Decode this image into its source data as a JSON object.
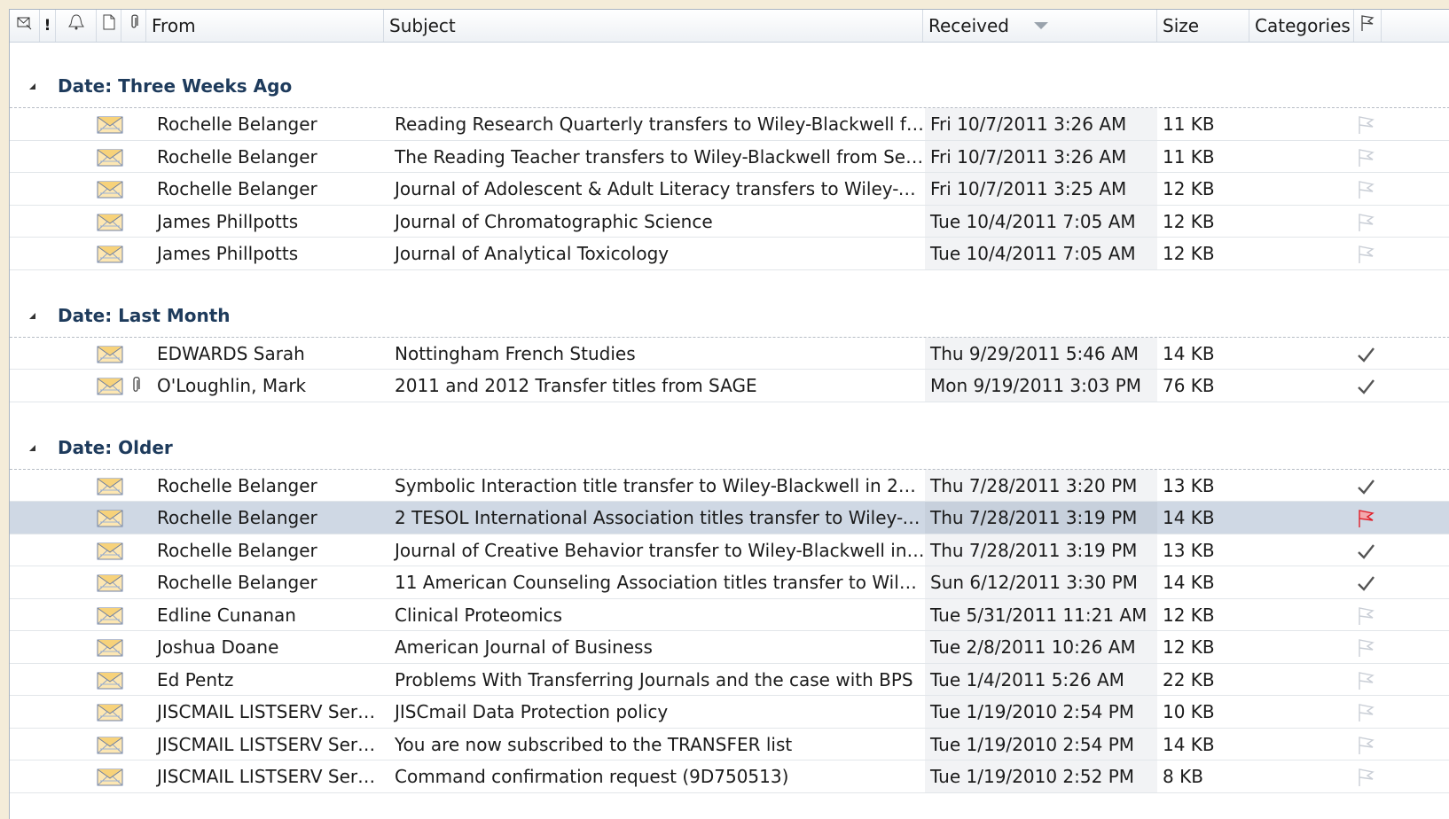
{
  "header": {
    "icons": [
      "importance-icon",
      "reminder-icon",
      "document-icon",
      "attachment-icon"
    ],
    "from": "From",
    "subject": "Subject",
    "received": "Received",
    "size": "Size",
    "categories": "Categories",
    "sorted_column": "Received",
    "sort_direction": "descending"
  },
  "groups": [
    {
      "title": "Date: Three Weeks Ago",
      "rows": [
        {
          "from": "Rochelle Belanger",
          "subject": "Reading Research Quarterly transfers to Wiley-Blackwell fr...",
          "received": "Fri 10/7/2011 3:26 AM",
          "size": "11 KB",
          "flag": "flag",
          "attachment": false
        },
        {
          "from": "Rochelle Belanger",
          "subject": "The Reading Teacher transfers to Wiley-Blackwell from Sep...",
          "received": "Fri 10/7/2011 3:26 AM",
          "size": "11 KB",
          "flag": "flag",
          "attachment": false
        },
        {
          "from": "Rochelle Belanger",
          "subject": "Journal of Adolescent & Adult Literacy transfers to Wiley-Bl...",
          "received": "Fri 10/7/2011 3:25 AM",
          "size": "12 KB",
          "flag": "flag",
          "attachment": false
        },
        {
          "from": "James Phillpotts",
          "subject": "Journal of Chromatographic Science",
          "received": "Tue 10/4/2011 7:05 AM",
          "size": "12 KB",
          "flag": "flag",
          "attachment": false
        },
        {
          "from": "James Phillpotts",
          "subject": "Journal of Analytical Toxicology",
          "received": "Tue 10/4/2011 7:05 AM",
          "size": "12 KB",
          "flag": "flag",
          "attachment": false
        }
      ]
    },
    {
      "title": "Date: Last Month",
      "rows": [
        {
          "from": "EDWARDS Sarah",
          "subject": "Nottingham French Studies",
          "received": "Thu 9/29/2011 5:46 AM",
          "size": "14 KB",
          "flag": "check",
          "attachment": false
        },
        {
          "from": "O'Loughlin, Mark",
          "subject": "2011 and 2012 Transfer titles from SAGE",
          "received": "Mon 9/19/2011 3:03 PM",
          "size": "76 KB",
          "flag": "check",
          "attachment": true
        }
      ]
    },
    {
      "title": "Date: Older",
      "rows": [
        {
          "from": "Rochelle Belanger",
          "subject": "Symbolic Interaction title transfer to Wiley-Blackwell in 2012",
          "received": "Thu 7/28/2011 3:20 PM",
          "size": "13 KB",
          "flag": "check",
          "attachment": false
        },
        {
          "from": "Rochelle Belanger",
          "subject": "2 TESOL International Association titles transfer to Wiley-Bl...",
          "received": "Thu 7/28/2011 3:19 PM",
          "size": "14 KB",
          "flag": "red-flag",
          "attachment": false,
          "selected": true
        },
        {
          "from": "Rochelle Belanger",
          "subject": "Journal of Creative Behavior transfer to Wiley-Blackwell in ...",
          "received": "Thu 7/28/2011 3:19 PM",
          "size": "13 KB",
          "flag": "check",
          "attachment": false
        },
        {
          "from": "Rochelle Belanger",
          "subject": "11 American Counseling Association titles transfer to Wiley...",
          "received": "Sun 6/12/2011 3:30 PM",
          "size": "14 KB",
          "flag": "check",
          "attachment": false
        },
        {
          "from": "Edline Cunanan",
          "subject": "Clinical Proteomics",
          "received": "Tue 5/31/2011 11:21 AM",
          "size": "12 KB",
          "flag": "flag",
          "attachment": false
        },
        {
          "from": "Joshua Doane",
          "subject": "American Journal of Business",
          "received": "Tue 2/8/2011 10:26 AM",
          "size": "12 KB",
          "flag": "flag",
          "attachment": false
        },
        {
          "from": "Ed Pentz",
          "subject": "Problems With Transferring Journals and the case with BPS",
          "received": "Tue 1/4/2011 5:26 AM",
          "size": "22 KB",
          "flag": "flag",
          "attachment": false
        },
        {
          "from": "JISCMAIL LISTSERV Server...",
          "subject": "JISCmail Data Protection policy",
          "received": "Tue 1/19/2010 2:54 PM",
          "size": "10 KB",
          "flag": "flag",
          "attachment": false
        },
        {
          "from": "JISCMAIL LISTSERV Server...",
          "subject": "You are now subscribed to the TRANSFER list",
          "received": "Tue 1/19/2010 2:54 PM",
          "size": "14 KB",
          "flag": "flag",
          "attachment": false
        },
        {
          "from": "JISCMAIL LISTSERV Server...",
          "subject": "Command confirmation request (9D750513)",
          "received": "Tue 1/19/2010 2:52 PM",
          "size": "8 KB",
          "flag": "flag",
          "attachment": false
        }
      ]
    }
  ],
  "colors": {
    "selected_row": "#cfd8e4",
    "group_title": "#1e3b5c",
    "flag_red": "#e0202a",
    "background": "#f4ecd9"
  }
}
